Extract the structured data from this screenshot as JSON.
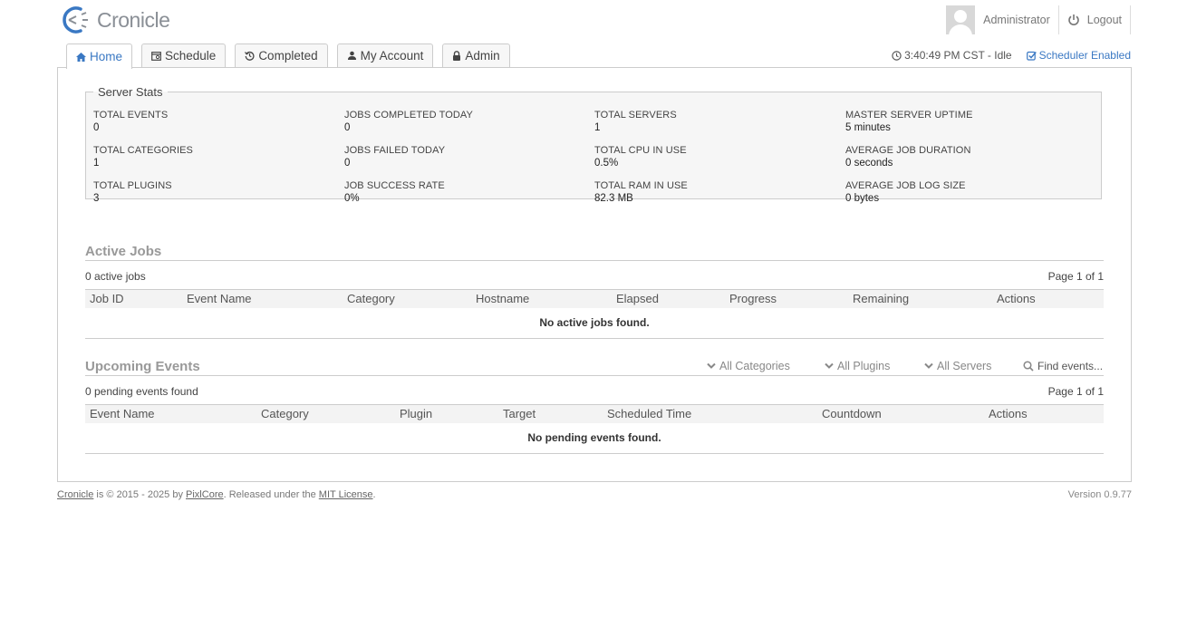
{
  "app": {
    "name": "Cronicle"
  },
  "header": {
    "username": "Administrator",
    "logout_label": "Logout"
  },
  "tabs": [
    {
      "label": "Home",
      "icon": "home-icon",
      "active": true
    },
    {
      "label": "Schedule",
      "icon": "calendar-icon",
      "active": false
    },
    {
      "label": "Completed",
      "icon": "history-icon",
      "active": false
    },
    {
      "label": "My Account",
      "icon": "user-icon",
      "active": false
    },
    {
      "label": "Admin",
      "icon": "lock-icon",
      "active": false
    }
  ],
  "status": {
    "clock": "3:40:49 PM CST - Idle",
    "scheduler": "Scheduler Enabled"
  },
  "server_stats": {
    "title": "Server Stats",
    "items": [
      {
        "label": "TOTAL EVENTS",
        "value": "0"
      },
      {
        "label": "JOBS COMPLETED TODAY",
        "value": "0"
      },
      {
        "label": "TOTAL SERVERS",
        "value": "1"
      },
      {
        "label": "MASTER SERVER UPTIME",
        "value": "5 minutes"
      },
      {
        "label": "TOTAL CATEGORIES",
        "value": "1"
      },
      {
        "label": "JOBS FAILED TODAY",
        "value": "0"
      },
      {
        "label": "TOTAL CPU IN USE",
        "value": "0.5%"
      },
      {
        "label": "AVERAGE JOB DURATION",
        "value": "0 seconds"
      },
      {
        "label": "TOTAL PLUGINS",
        "value": "3"
      },
      {
        "label": "JOB SUCCESS RATE",
        "value": "0%"
      },
      {
        "label": "TOTAL RAM IN USE",
        "value": "82.3 MB"
      },
      {
        "label": "AVERAGE JOB LOG SIZE",
        "value": "0 bytes"
      }
    ]
  },
  "active_jobs": {
    "title": "Active Jobs",
    "count": "0 active jobs",
    "pagination": "Page 1 of 1",
    "columns": [
      "Job ID",
      "Event Name",
      "Category",
      "Hostname",
      "Elapsed",
      "Progress",
      "Remaining",
      "Actions"
    ],
    "empty": "No active jobs found."
  },
  "upcoming": {
    "title": "Upcoming Events",
    "count": "0 pending events found",
    "pagination": "Page 1 of 1",
    "filters": {
      "categories": "All Categories",
      "plugins": "All Plugins",
      "servers": "All Servers",
      "search_placeholder": "Find events..."
    },
    "columns": [
      "Event Name",
      "Category",
      "Plugin",
      "Target",
      "Scheduled Time",
      "Countdown",
      "Actions"
    ],
    "empty": "No pending events found."
  },
  "footer": {
    "app_link": "Cronicle",
    "text1": " is © 2015 - 2025 by ",
    "author_link": "PixlCore",
    "text2": ". Released under the ",
    "license_link": "MIT License",
    "text3": ".",
    "version": "Version 0.9.77"
  },
  "colors": {
    "accent": "#3a78c3",
    "muted_title": "#999999",
    "panel_bg": "#f6f6f6"
  }
}
